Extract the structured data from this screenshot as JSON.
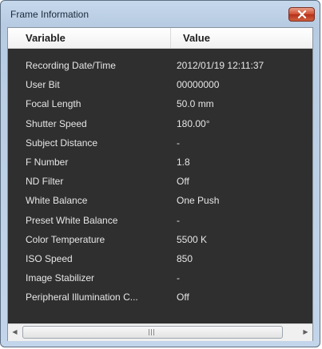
{
  "window": {
    "title": "Frame Information"
  },
  "icons": {
    "close": "close-icon"
  },
  "table": {
    "columns": [
      "Variable",
      "Value"
    ],
    "rows": [
      {
        "variable": "Recording Date/Time",
        "value": "2012/01/19 12:11:37"
      },
      {
        "variable": "User Bit",
        "value": "00000000"
      },
      {
        "variable": "Focal Length",
        "value": "50.0 mm"
      },
      {
        "variable": "Shutter Speed",
        "value": "180.00°"
      },
      {
        "variable": "Subject Distance",
        "value": "-"
      },
      {
        "variable": "F Number",
        "value": "1.8"
      },
      {
        "variable": "ND Filter",
        "value": "Off"
      },
      {
        "variable": "White Balance",
        "value": "One Push"
      },
      {
        "variable": "Preset White Balance",
        "value": "-"
      },
      {
        "variable": "Color Temperature",
        "value": "5500 K"
      },
      {
        "variable": "ISO Speed",
        "value": "850"
      },
      {
        "variable": "Image Stabilizer",
        "value": "-"
      },
      {
        "variable": "Peripheral Illumination C...",
        "value": "Off"
      }
    ]
  },
  "colors": {
    "grid_background": "#2f2f2f",
    "grid_text": "#e6e6e6",
    "close_button": "#cf4b2d"
  }
}
